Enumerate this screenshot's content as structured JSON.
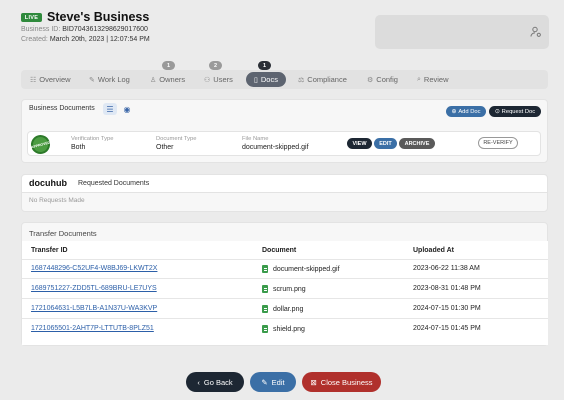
{
  "header": {
    "live_badge": "LIVE",
    "business_name": "Steve's Business",
    "business_id_label": "Business ID:",
    "business_id": "BID7043613298629017600",
    "created_label": "Created:",
    "created": "March 20th, 2023 | 12:07:54 PM"
  },
  "tabs": [
    {
      "label": "Overview",
      "icon": "grid-icon"
    },
    {
      "label": "Work Log",
      "icon": "wrench-icon"
    },
    {
      "label": "Owners",
      "icon": "person-icon",
      "count": "1"
    },
    {
      "label": "Users",
      "icon": "users-icon",
      "count": "2"
    },
    {
      "label": "Docs",
      "icon": "document-icon",
      "count": "1",
      "active": true
    },
    {
      "label": "Compliance",
      "icon": "compliance-icon"
    },
    {
      "label": "Config",
      "icon": "gear-icon"
    },
    {
      "label": "Review",
      "icon": "search-icon"
    }
  ],
  "business_documents": {
    "title": "Business Documents",
    "add_doc": "Add Doc",
    "request_doc": "Request Doc",
    "doc": {
      "status_stamp": "APPROVED",
      "verification_type_label": "Verification Type",
      "verification_type": "Both",
      "document_type_label": "Document Type",
      "document_type": "Other",
      "file_name_label": "File Name",
      "file_name": "document-skipped.gif",
      "view": "VIEW",
      "edit": "EDIT",
      "archive": "ARCHIVE",
      "reverify": "RE-VERIFY"
    }
  },
  "docuhub": {
    "logo": "docuhub",
    "title": "Requested Documents",
    "empty": "No Requests Made"
  },
  "transfer": {
    "title": "Transfer Documents",
    "columns": [
      "Transfer ID",
      "Document",
      "Uploaded At"
    ],
    "rows": [
      [
        "1687448296-C52UF4-W8BJ69-LKWT2X",
        "document-skipped.gif",
        "2023-06-22 11:38 AM"
      ],
      [
        "1689751227-ZDD5TL-689BRU-LE7UYS",
        "scrum.png",
        "2023-08-31 01:48 PM"
      ],
      [
        "1721064631-L5B7LB-A1N37U-WA3KVP",
        "dollar.png",
        "2024-07-15 01:30 PM"
      ],
      [
        "1721065501-2AHT7P-LTTUTB-8PLZ51",
        "shield.png",
        "2024-07-15 01:45 PM"
      ]
    ]
  },
  "footer": {
    "go_back": "Go Back",
    "edit": "Edit",
    "close_business": "Close Business"
  },
  "colors": {
    "live_green": "#2f8a3c",
    "active_tab": "#5d6470",
    "link_blue": "#2c5fa8",
    "edit_blue": "#3b6fa6",
    "dark_navy": "#1d2733",
    "close_red": "#b0302c"
  }
}
